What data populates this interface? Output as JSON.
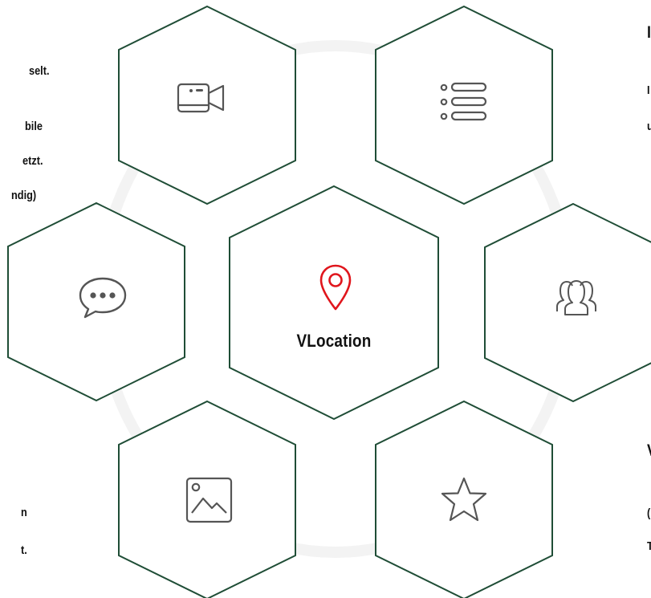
{
  "center": {
    "label": "VLocation",
    "icon": "map-pin-icon",
    "accent": "#e0151c"
  },
  "hex_colors": {
    "stroke": "#1f4d36",
    "icon": "#555555"
  },
  "hexagons": [
    {
      "id": "video",
      "icon": "video-camera-icon"
    },
    {
      "id": "list",
      "icon": "list-icon"
    },
    {
      "id": "chat",
      "icon": "chat-bubble-icon"
    },
    {
      "id": "users",
      "icon": "users-group-icon"
    },
    {
      "id": "image",
      "icon": "image-icon"
    },
    {
      "id": "star",
      "icon": "star-icon"
    }
  ],
  "left_text": [
    "selt.",
    "bile",
    "etzt.",
    "ndig)"
  ],
  "left_text_bottom": [
    "n",
    "t."
  ],
  "right_text": [
    "I",
    "I",
    "u",
    "V",
    "(",
    "T"
  ]
}
